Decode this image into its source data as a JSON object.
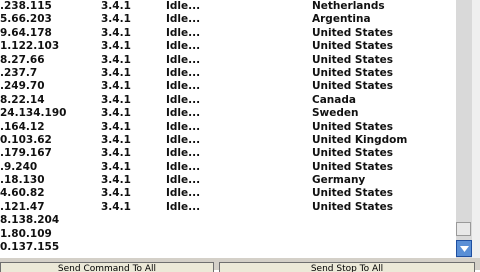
{
  "rows": [
    {
      "ip": ".238.115",
      "version": "3.4.1",
      "status": "Idle...",
      "country": "Netherlands"
    },
    {
      "ip": "5.66.203",
      "version": "3.4.1",
      "status": "Idle...",
      "country": "Argentina"
    },
    {
      "ip": "9.64.178",
      "version": "3.4.1",
      "status": "Idle...",
      "country": "United States"
    },
    {
      "ip": "1.122.103",
      "version": "3.4.1",
      "status": "Idle...",
      "country": "United States"
    },
    {
      "ip": "8.27.66",
      "version": "3.4.1",
      "status": "Idle...",
      "country": "United States"
    },
    {
      "ip": ".237.7",
      "version": "3.4.1",
      "status": "Idle...",
      "country": "United States"
    },
    {
      "ip": ".249.70",
      "version": "3.4.1",
      "status": "Idle...",
      "country": "United States"
    },
    {
      "ip": "8.22.14",
      "version": "3.4.1",
      "status": "Idle...",
      "country": "Canada"
    },
    {
      "ip": "24.134.190",
      "version": "3.4.1",
      "status": "Idle...",
      "country": "Sweden"
    },
    {
      "ip": ".164.12",
      "version": "3.4.1",
      "status": "Idle...",
      "country": "United States"
    },
    {
      "ip": "0.103.62",
      "version": "3.4.1",
      "status": "Idle...",
      "country": "United Kingdom"
    },
    {
      "ip": ".179.167",
      "version": "3.4.1",
      "status": "Idle...",
      "country": "United States"
    },
    {
      "ip": ".9.240",
      "version": "3.4.1",
      "status": "Idle...",
      "country": "United States"
    },
    {
      "ip": ".18.130",
      "version": "3.4.1",
      "status": "Idle...",
      "country": "Germany"
    },
    {
      "ip": "4.60.82",
      "version": "3.4.1",
      "status": "Idle...",
      "country": "United States"
    },
    {
      "ip": ".121.47",
      "version": "3.4.1",
      "status": "Idle...",
      "country": "United States"
    },
    {
      "ip": "8.138.204",
      "version": "",
      "status": "",
      "country": ""
    },
    {
      "ip": "1.80.109",
      "version": "",
      "status": "",
      "country": ""
    },
    {
      "ip": "0.137.155",
      "version": "",
      "status": "",
      "country": ""
    }
  ],
  "scrollbar": {
    "thumb_icon": "scroll-thumb",
    "down_icon": "chevron-down-icon",
    "accent": "#5a8fd6"
  },
  "buttons": {
    "left_label": "Send Command To All",
    "right_label": "Send Stop To All"
  }
}
